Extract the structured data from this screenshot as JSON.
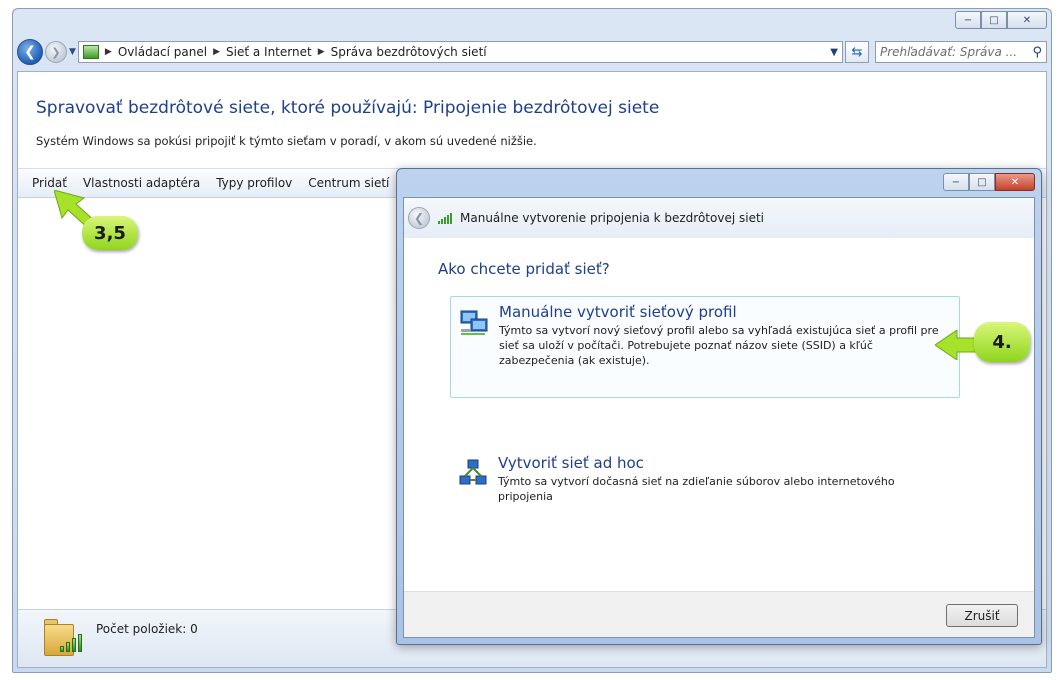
{
  "window": {
    "caption_min": "−",
    "caption_max": "□",
    "caption_close": "✕"
  },
  "nav": {
    "breadcrumbs": [
      "Ovládací panel",
      "Sieť a Internet",
      "Správa bezdrôtových sietí"
    ],
    "search_placeholder": "Prehľadávať: Správa ..."
  },
  "page": {
    "title": "Spravovať bezdrôtové siete, ktoré používajú: Pripojenie bezdrôtovej siete",
    "subtitle": "Systém Windows sa pokúsi pripojiť k týmto sieťam v poradí, v akom sú uvedené nižšie."
  },
  "toolbar": {
    "items": [
      "Pridať",
      "Vlastnosti adaptéra",
      "Typy profilov",
      "Centrum sietí"
    ]
  },
  "details": {
    "item_count": "Počet položiek: 0"
  },
  "dialog": {
    "title": "Manuálne vytvorenie pripojenia k bezdrôtovej sieti",
    "question": "Ako chcete pridať sieť?",
    "options": [
      {
        "title": "Manuálne vytvoriť sieťový profil",
        "description": "Týmto sa vytvorí nový sieťový profil alebo sa vyhľadá existujúca sieť a profil pre sieť sa uloží v počítači. Potrebujete poznať názov siete (SSID) a kľúč zabezpečenia (ak existuje)."
      },
      {
        "title": "Vytvoriť sieť ad hoc",
        "description": "Týmto sa vytvorí dočasná sieť na zdieľanie súborov alebo internetového pripojenia"
      }
    ],
    "cancel_label": "Zrušiť"
  },
  "callouts": {
    "step_a": "3,5",
    "step_b": "4."
  },
  "colors": {
    "accent": "#1e3e8f",
    "callout": "#a6e22a"
  }
}
